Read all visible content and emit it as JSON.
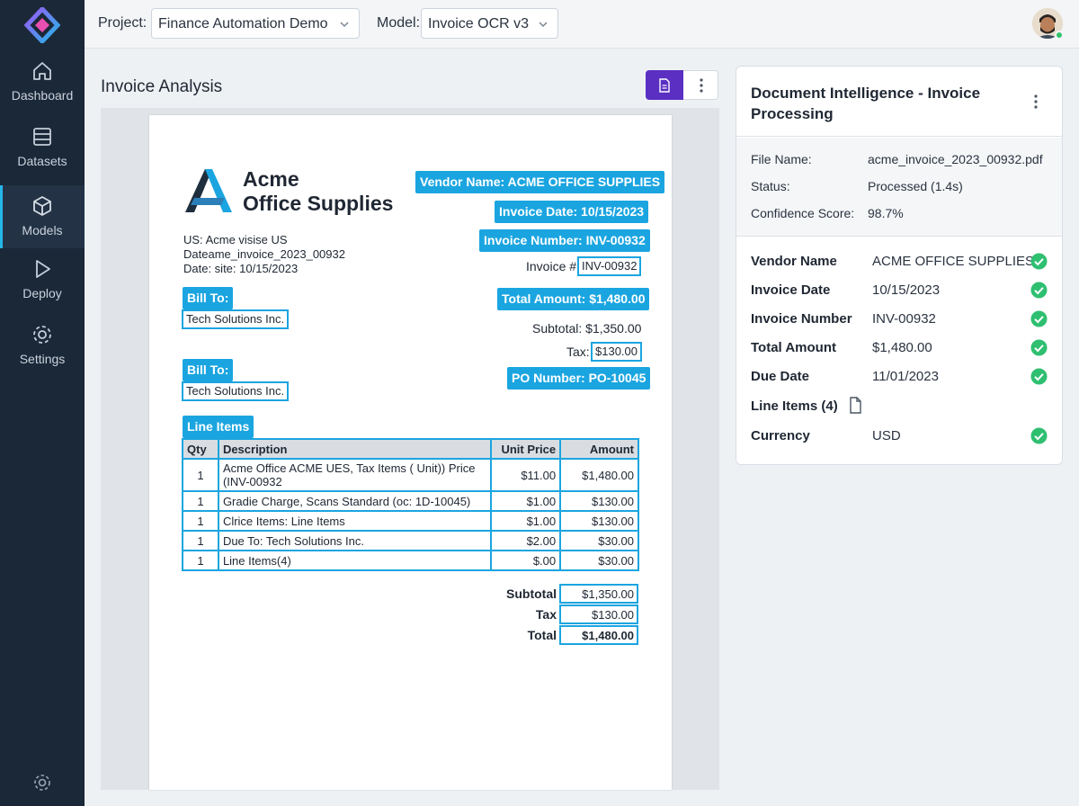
{
  "sidebar": {
    "items": [
      {
        "label": "Dashboard",
        "icon": "home-icon"
      },
      {
        "label": "Datasets",
        "icon": "database-icon"
      },
      {
        "label": "Models",
        "icon": "cube-icon"
      },
      {
        "label": "Deploy",
        "icon": "play-icon"
      },
      {
        "label": "Settings",
        "icon": "gear-icon"
      }
    ],
    "active": "Models",
    "accent": "#25b6e8"
  },
  "topbar": {
    "project_label": "Project:",
    "project_value": "Finance Automation Demo",
    "model_label": "Model:",
    "model_value": "Invoice OCR v3",
    "user_status": "online"
  },
  "main": {
    "title": "Invoice Analysis"
  },
  "document": {
    "brand_line1": "Acme",
    "brand_line2": "Office Supplies",
    "meta": [
      "US: Acme visise US",
      "Dateame_invoice_2023_00932",
      "Date: site: 10/15/2023"
    ],
    "tags": {
      "vendor": "Vendor Name: ACME OFFICE SUPPLIES",
      "invoice_date": "Invoice Date: 10/15/2023",
      "invoice_number": "Invoice Number: INV-00932",
      "invoice_hash_label": "Invoice #:",
      "invoice_hash_value": "INV-00932",
      "total_amount": "Total Amount: $1,480.00",
      "subtotal_text": "Subtotal: $1,350.00",
      "tax_label": "Tax:",
      "tax_value": "$130.00",
      "po_number": "PO Number: PO-10045",
      "bill_to_1": "Bill To:",
      "bill_to_1_value": "Tech Solutions Inc.",
      "bill_to_2": "Bill To:",
      "bill_to_2_value": "Tech Solutions Inc.",
      "line_items": "Line Items"
    },
    "table": {
      "headers": [
        "Qty",
        "Description",
        "Unit Price",
        "Amount"
      ],
      "rows": [
        [
          "1",
          "Acme Office ACME UES, Tax Items ( Unit)) Price (INV-00932",
          "$11.00",
          "$1,480.00"
        ],
        [
          "1",
          "Gradie Charge, Scans Standard (oc:  1D-10045)",
          "$1.00",
          "$130.00"
        ],
        [
          "1",
          "Clrice Items:  Line Items",
          "$1.00",
          "$130.00"
        ],
        [
          "1",
          "Due To:  Tech Solutions Inc.",
          "$2.00",
          "$30.00"
        ],
        [
          "1",
          "Line Items(4)",
          "$.00",
          "$30.00"
        ]
      ]
    },
    "totals": [
      {
        "label": "Subtotal",
        "value": "$1,350.00"
      },
      {
        "label": "Tax",
        "value": "$130.00"
      },
      {
        "label": "Total",
        "value": "$1,480.00"
      }
    ]
  },
  "panel": {
    "title": "Document Intelligence - Invoice Processing",
    "file_info": [
      {
        "label": "File Name:",
        "value": "acme_invoice_2023_00932.pdf"
      },
      {
        "label": "Status:",
        "value": "Processed (1.4s)"
      },
      {
        "label": "Confidence Score:",
        "value": "98.7%"
      }
    ],
    "fields": [
      {
        "label": "Vendor Name",
        "value": "ACME OFFICE SUPPLIES",
        "verified": true
      },
      {
        "label": "Invoice Date",
        "value": "10/15/2023",
        "verified": true
      },
      {
        "label": "Invoice Number",
        "value": "INV-00932",
        "verified": true
      },
      {
        "label": "Total Amount",
        "value": "$1,480.00",
        "verified": true
      },
      {
        "label": "Due Date",
        "value": "11/01/2023",
        "verified": true
      },
      {
        "label": "Line Items (4)",
        "value": "",
        "verified": false
      },
      {
        "label": "Currency",
        "value": "USD",
        "verified": true
      }
    ],
    "check_color": "#2fbf71"
  },
  "colors": {
    "sidebar_bg": "#1b2838",
    "tag_blue": "#1ba5e0",
    "primary_purple": "#5a2fc2"
  }
}
